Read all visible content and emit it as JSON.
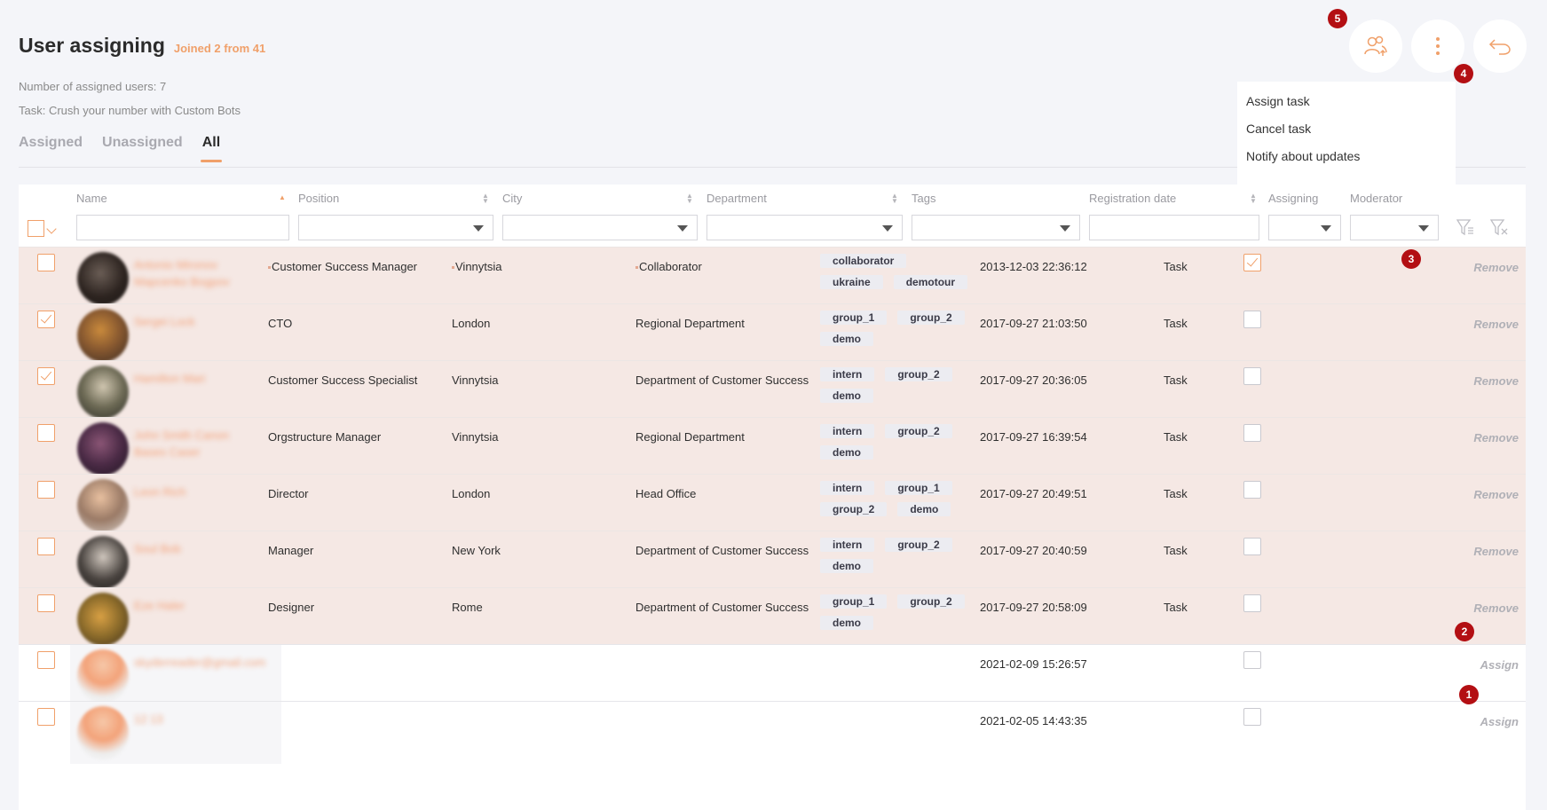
{
  "page": {
    "title": "User assigning",
    "joined": "Joined 2 from 41",
    "assigned_count_text": "Number of assigned users: 7",
    "task_text": "Task: Crush your number with Custom Bots"
  },
  "tabs": [
    {
      "label": "Assigned",
      "active": false
    },
    {
      "label": "Unassigned",
      "active": false
    },
    {
      "label": "All",
      "active": true
    }
  ],
  "toolbar": {
    "assign_users_icon": "users-upload-icon",
    "more_icon": "vertical-dots-icon",
    "back_icon": "undo-arrow-icon"
  },
  "menu": {
    "items": [
      "Assign task",
      "Cancel task",
      "Notify about updates"
    ]
  },
  "badges": [
    "1",
    "2",
    "3",
    "4",
    "5"
  ],
  "columns": {
    "name": "Name",
    "position": "Position",
    "city": "City",
    "department": "Department",
    "tags": "Tags",
    "registration": "Registration date",
    "assigning": "Assigning",
    "moderator": "Moderator"
  },
  "rows": [
    {
      "name": "Antonio Mironov Mapcenko Bogpov",
      "position": "Customer Success Manager",
      "city": "Vinnytsia",
      "department": "Collaborator",
      "tags": [
        "collaborator",
        "ukraine",
        "demotour"
      ],
      "date": "2013-12-03 22:36:12",
      "assigning": "Task",
      "selected": false,
      "moderator": true,
      "action": "Remove",
      "assigned": true
    },
    {
      "name": "Sergei Lock",
      "position": "CTO",
      "city": "London",
      "department": "Regional Department",
      "tags": [
        "group_1",
        "group_2",
        "demo"
      ],
      "date": "2017-09-27 21:03:50",
      "assigning": "Task",
      "selected": true,
      "moderator": false,
      "action": "Remove",
      "assigned": true
    },
    {
      "name": "Hamilton Mari",
      "position": "Customer Success Specialist",
      "city": "Vinnytsia",
      "department": "Department of Customer Success",
      "tags": [
        "intern",
        "group_2",
        "demo"
      ],
      "date": "2017-09-27 20:36:05",
      "assigning": "Task",
      "selected": true,
      "moderator": false,
      "action": "Remove",
      "assigned": true
    },
    {
      "name": "John Smith Canon Bases Caser",
      "position": "Orgstructure Manager",
      "city": "Vinnytsia",
      "department": "Regional Department",
      "tags": [
        "intern",
        "group_2",
        "demo"
      ],
      "date": "2017-09-27 16:39:54",
      "assigning": "Task",
      "selected": false,
      "moderator": false,
      "action": "Remove",
      "assigned": true
    },
    {
      "name": "Leon Rich",
      "position": "Director",
      "city": "London",
      "department": "Head Office",
      "tags": [
        "intern",
        "group_1",
        "group_2",
        "demo"
      ],
      "date": "2017-09-27 20:49:51",
      "assigning": "Task",
      "selected": false,
      "moderator": false,
      "action": "Remove",
      "assigned": true
    },
    {
      "name": "Soul Bob",
      "position": "Manager",
      "city": "New York",
      "department": "Department of Customer Success",
      "tags": [
        "intern",
        "group_2",
        "demo"
      ],
      "date": "2017-09-27 20:40:59",
      "assigning": "Task",
      "selected": false,
      "moderator": false,
      "action": "Remove",
      "assigned": true
    },
    {
      "name": "Eze Haler",
      "position": "Designer",
      "city": "Rome",
      "department": "Department of Customer Success",
      "tags": [
        "group_1",
        "group_2",
        "demo"
      ],
      "date": "2017-09-27 20:58:09",
      "assigning": "Task",
      "selected": false,
      "moderator": false,
      "action": "Remove",
      "assigned": true
    },
    {
      "name": "skyderreader@gmail.com",
      "position": "",
      "city": "",
      "department": "",
      "tags": [],
      "date": "2021-02-09 15:26:57",
      "assigning": "",
      "selected": false,
      "moderator": false,
      "action": "Assign",
      "assigned": false
    },
    {
      "name": "12 13",
      "position": "",
      "city": "",
      "department": "",
      "tags": [],
      "date": "2021-02-05 14:43:35",
      "assigning": "",
      "selected": false,
      "moderator": false,
      "action": "Assign",
      "assigned": false
    }
  ],
  "colors": {
    "accent": "#f0a06a",
    "badge": "#b30f13",
    "row_tint": "#f5e8e4"
  }
}
